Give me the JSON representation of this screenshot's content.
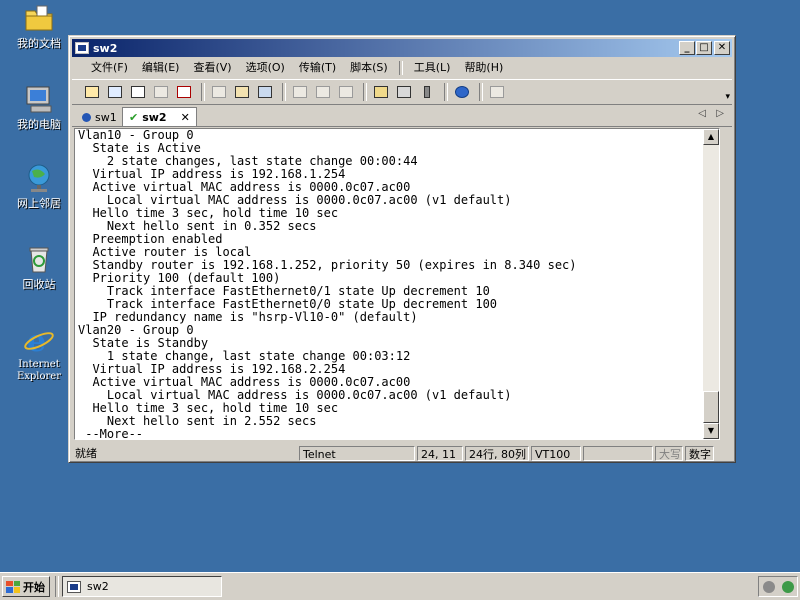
{
  "desktop": {
    "icons": [
      {
        "label": "我的文档",
        "icon": "my-documents-icon"
      },
      {
        "label": "我的电脑",
        "icon": "my-computer-icon"
      },
      {
        "label": "网上邻居",
        "icon": "network-places-icon"
      },
      {
        "label": "回收站",
        "icon": "recycle-bin-icon"
      },
      {
        "label_line1": "Internet",
        "label_line2": "Explorer",
        "icon": "internet-explorer-icon"
      }
    ]
  },
  "window": {
    "title": "sw2",
    "buttons": {
      "minimize": "_",
      "maximize": "□",
      "close": "✕"
    },
    "menu": [
      "文件(F)",
      "编辑(E)",
      "查看(V)",
      "选项(O)",
      "传输(T)",
      "脚本(S)",
      "工具(L)",
      "帮助(H)"
    ],
    "toolbar_overflow": "▾",
    "tabs": [
      {
        "label": "sw1",
        "active": false
      },
      {
        "label": "sw2",
        "active": true,
        "close": "✕"
      }
    ],
    "tab_nav": {
      "left": "◁",
      "right": "▷"
    },
    "terminal_lines": [
      "Vlan10 - Group 0",
      "  State is Active",
      "    2 state changes, last state change 00:00:44",
      "  Virtual IP address is 192.168.1.254",
      "  Active virtual MAC address is 0000.0c07.ac00",
      "    Local virtual MAC address is 0000.0c07.ac00 (v1 default)",
      "  Hello time 3 sec, hold time 10 sec",
      "    Next hello sent in 0.352 secs",
      "  Preemption enabled",
      "  Active router is local",
      "  Standby router is 192.168.1.252, priority 50 (expires in 8.340 sec)",
      "  Priority 100 (default 100)",
      "    Track interface FastEthernet0/1 state Up decrement 10",
      "    Track interface FastEthernet0/0 state Up decrement 100",
      "  IP redundancy name is \"hsrp-Vl10-0\" (default)",
      "Vlan20 - Group 0",
      "  State is Standby",
      "    1 state change, last state change 00:03:12",
      "  Virtual IP address is 192.168.2.254",
      "  Active virtual MAC address is 0000.0c07.ac00",
      "    Local virtual MAC address is 0000.0c07.ac00 (v1 default)",
      "  Hello time 3 sec, hold time 10 sec",
      "    Next hello sent in 2.552 secs",
      " --More--"
    ],
    "scroll": {
      "up": "▲",
      "down": "▼"
    },
    "status": {
      "ready": "就绪",
      "protocol": "Telnet",
      "cursor": "24, 11",
      "size": "24行, 80列",
      "emulation": "VT100",
      "blank": "",
      "caps": "大写",
      "num": "数字"
    }
  },
  "taskbar": {
    "start_label": "开始",
    "task_label": "sw2"
  },
  "colors": {
    "desktop": "#3a6ea5",
    "title_start": "#0a246a",
    "title_end": "#a6caf0",
    "chrome": "#d4d0c8"
  }
}
